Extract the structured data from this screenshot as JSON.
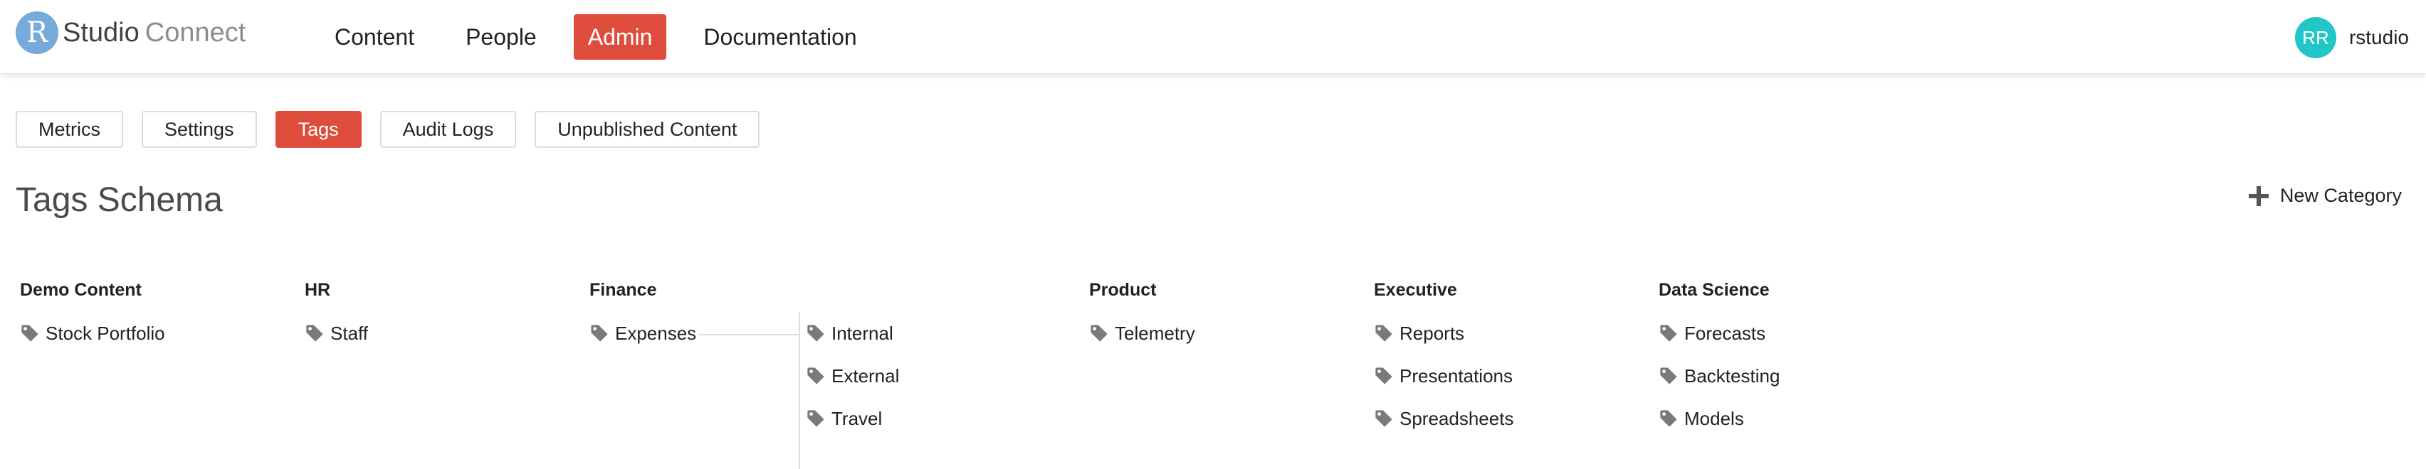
{
  "app": {
    "logo_letter": "R",
    "logo_name": "Studio",
    "logo_product": "Connect"
  },
  "nav": {
    "items": [
      {
        "label": "Content",
        "active": false
      },
      {
        "label": "People",
        "active": false
      },
      {
        "label": "Admin",
        "active": true
      },
      {
        "label": "Documentation",
        "active": false
      }
    ]
  },
  "user": {
    "initials": "RR",
    "name": "rstudio",
    "avatar_color": "#22c6c6"
  },
  "subtabs": [
    {
      "label": "Metrics",
      "active": false
    },
    {
      "label": "Settings",
      "active": false
    },
    {
      "label": "Tags",
      "active": true
    },
    {
      "label": "Audit Logs",
      "active": false
    },
    {
      "label": "Unpublished Content",
      "active": false
    }
  ],
  "page": {
    "title": "Tags Schema",
    "new_category_label": "New Category",
    "new_category_icon": "plus-icon"
  },
  "colors": {
    "accent": "#de4c3c",
    "logo": "#75aadb",
    "tag_icon": "#7a7a7a"
  },
  "categories": [
    {
      "name": "Demo Content",
      "tags": [
        "Stock Portfolio"
      ]
    },
    {
      "name": "HR",
      "tags": [
        "Staff"
      ]
    },
    {
      "name": "Finance",
      "tags": [
        "Expenses"
      ],
      "subtags": [
        "Internal",
        "External",
        "Travel"
      ]
    },
    {
      "name": "Product",
      "tags": [
        "Telemetry"
      ]
    },
    {
      "name": "Executive",
      "tags": [
        "Reports",
        "Presentations",
        "Spreadsheets"
      ]
    },
    {
      "name": "Data Science",
      "tags": [
        "Forecasts",
        "Backtesting",
        "Models"
      ]
    }
  ]
}
